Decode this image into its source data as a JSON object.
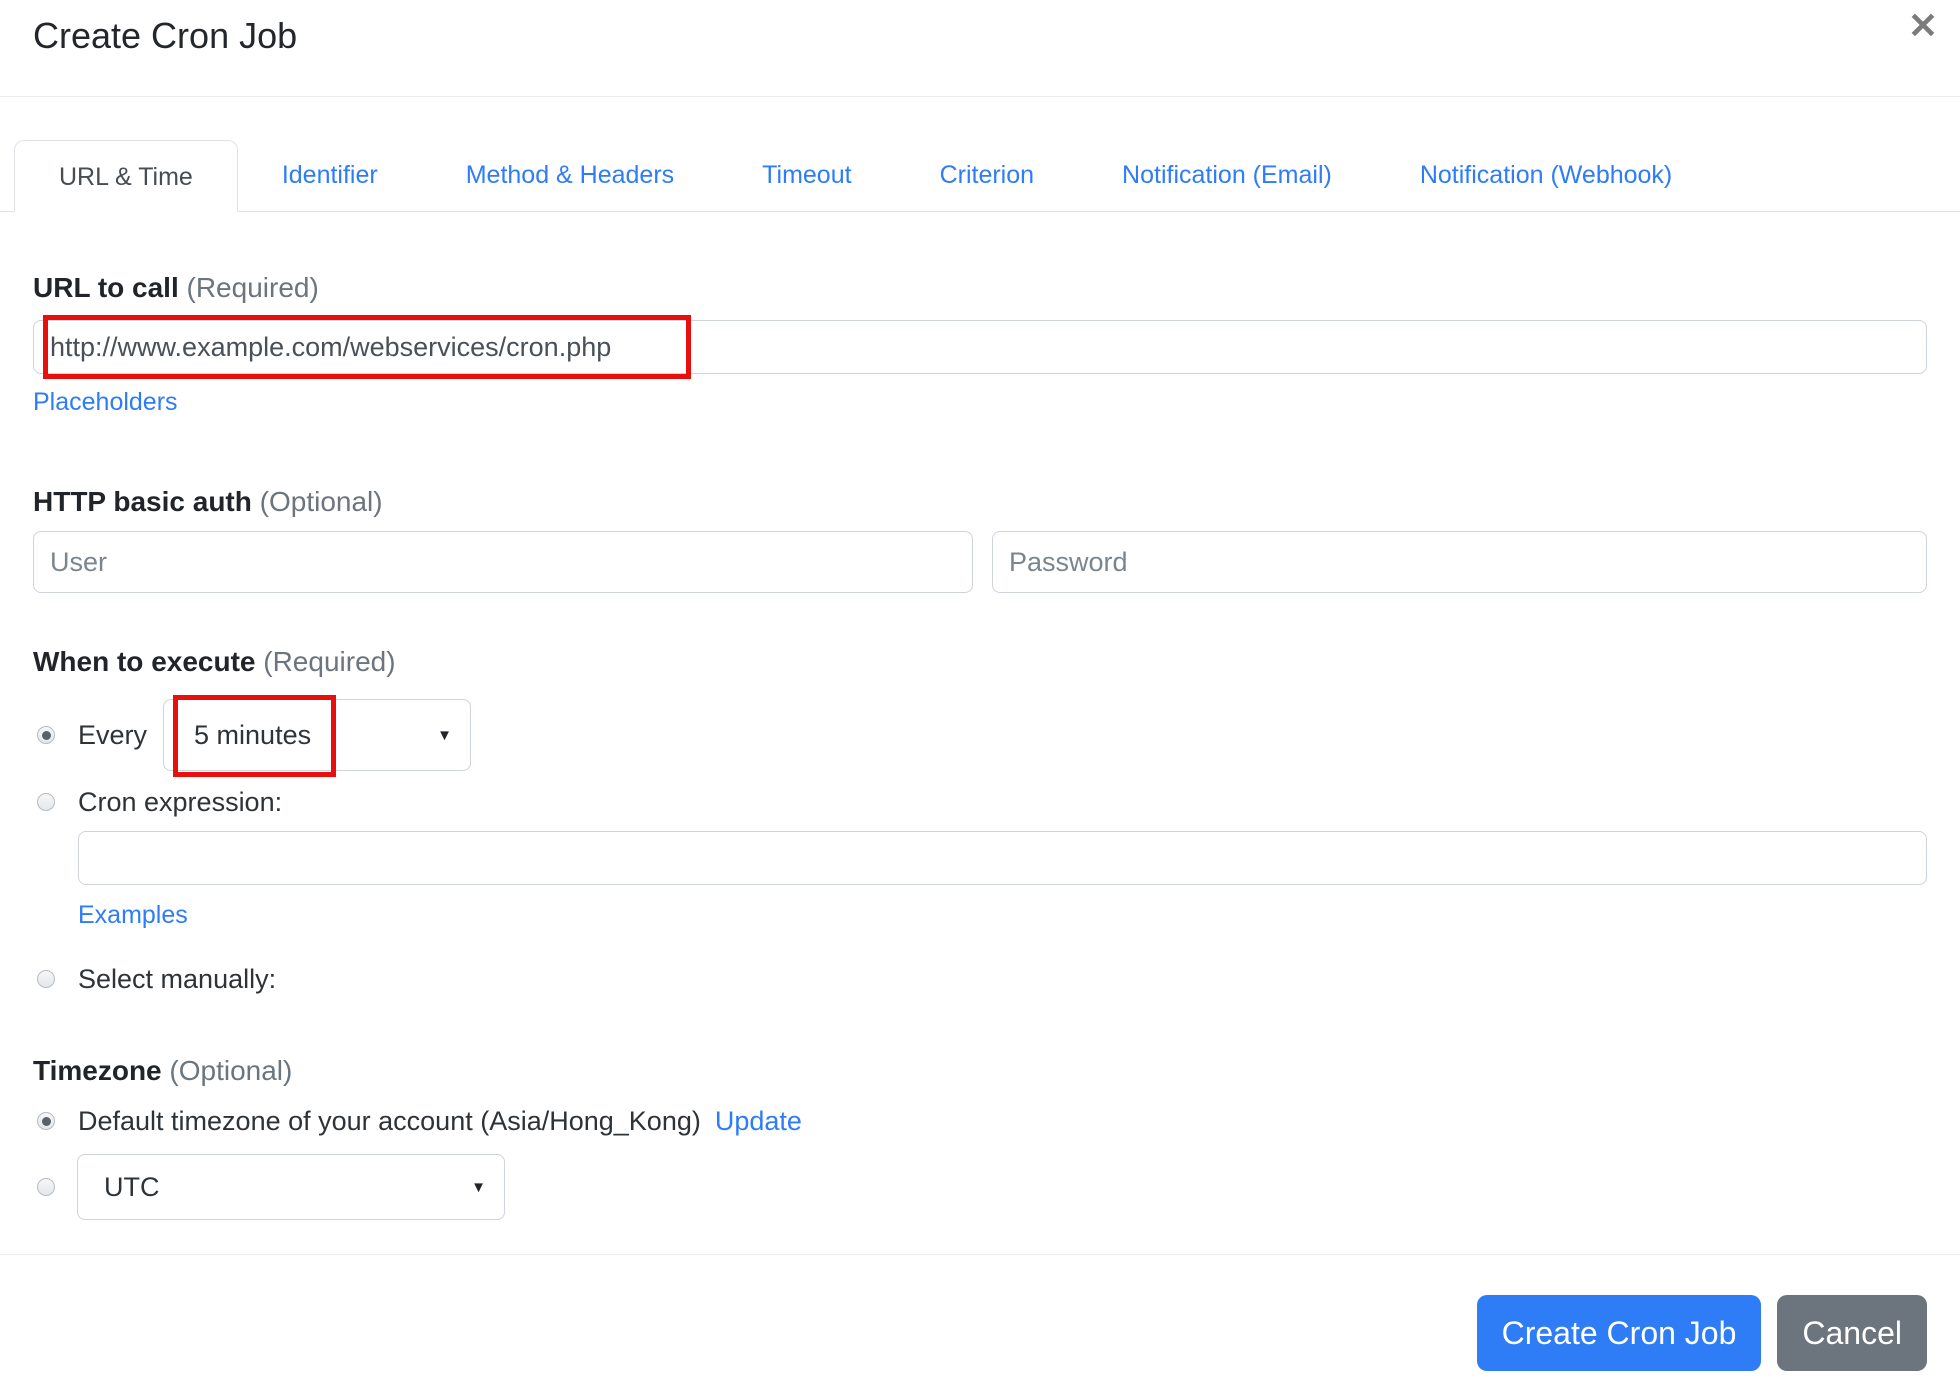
{
  "dialog": {
    "title": "Create Cron Job"
  },
  "icons": {
    "close": "✕",
    "caret": "▼"
  },
  "tabs": [
    {
      "label": "URL & Time",
      "active": true
    },
    {
      "label": "Identifier",
      "active": false
    },
    {
      "label": "Method & Headers",
      "active": false
    },
    {
      "label": "Timeout",
      "active": false
    },
    {
      "label": "Criterion",
      "active": false
    },
    {
      "label": "Notification (Email)",
      "active": false
    },
    {
      "label": "Notification (Webhook)",
      "active": false
    }
  ],
  "url_section": {
    "label": "URL to call",
    "required": "(Required)",
    "url_value": "http://www.example.com/webservices/cron.php",
    "placeholders_link": "Placeholders"
  },
  "auth_section": {
    "label": "HTTP basic auth",
    "optional": "(Optional)",
    "user_placeholder": "User",
    "password_placeholder": "Password"
  },
  "schedule_section": {
    "label": "When to execute",
    "required": "(Required)",
    "every_label": "Every",
    "every_value": "5 minutes",
    "every_selected": true,
    "cron_label": "Cron expression:",
    "cron_value": "",
    "cron_selected": false,
    "examples_link": "Examples",
    "manual_label": "Select manually:",
    "manual_selected": false
  },
  "timezone_section": {
    "label": "Timezone",
    "optional": "(Optional)",
    "default_label": "Default timezone of your account (Asia/Hong_Kong)",
    "default_selected": true,
    "update_link": "Update",
    "utc_value": "UTC",
    "utc_selected": false
  },
  "footer": {
    "create_label": "Create Cron Job",
    "cancel_label": "Cancel"
  },
  "colors": {
    "accent_blue": "#2e7cf6",
    "annotation_red": "#e8100c",
    "cancel_gray": "#6c757d",
    "border_gray": "#ced4da"
  }
}
